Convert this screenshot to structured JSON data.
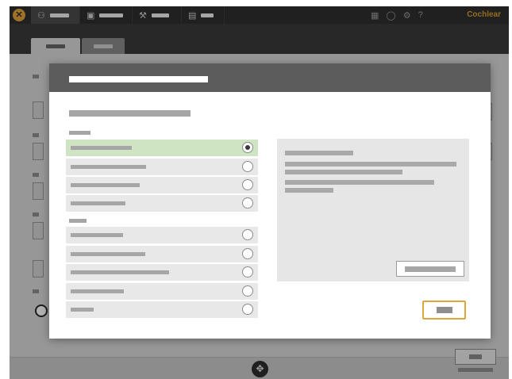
{
  "colors": {
    "topbar": "#2f2f2f",
    "accent": "#e0a63e",
    "selected_option": "#cfe4c2",
    "modal_header": "#5c5c5c"
  },
  "topbar": {
    "logo_icon": "cochlear-logo-icon",
    "brand": "Cochlear",
    "tabs": [
      {
        "icon": "user-icon",
        "active": true
      },
      {
        "icon": "device-icon",
        "active": false
      },
      {
        "icon": "wrench-icon",
        "active": false
      },
      {
        "icon": "document-icon",
        "active": false
      }
    ],
    "right_icons": [
      "report-icon",
      "chat-icon",
      "settings-icon",
      "help-icon"
    ]
  },
  "modal": {
    "groups": [
      {
        "options": [
          {
            "selected": true
          },
          {
            "selected": false
          },
          {
            "selected": false
          },
          {
            "selected": false
          }
        ]
      },
      {
        "options": [
          {
            "selected": false
          },
          {
            "selected": false
          },
          {
            "selected": false
          },
          {
            "selected": false
          },
          {
            "selected": false
          }
        ]
      }
    ]
  },
  "bottom": {
    "center_icon": "compass-icon"
  }
}
